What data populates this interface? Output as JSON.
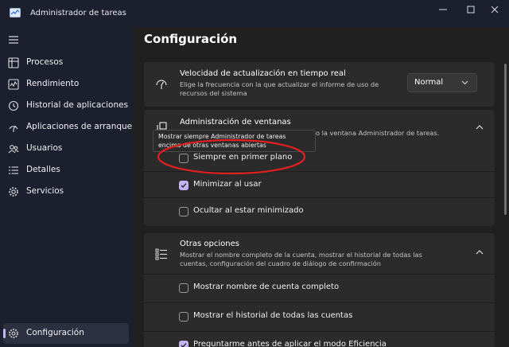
{
  "window": {
    "title": "Administrador de tareas",
    "controls": [
      "minimize",
      "maximize",
      "close"
    ]
  },
  "sidebar": {
    "items": [
      {
        "label": "Procesos",
        "icon": "processes-icon"
      },
      {
        "label": "Rendimiento",
        "icon": "performance-icon"
      },
      {
        "label": "Historial de aplicaciones",
        "icon": "history-icon"
      },
      {
        "label": "Aplicaciones de arranque",
        "icon": "startup-icon"
      },
      {
        "label": "Usuarios",
        "icon": "users-icon"
      },
      {
        "label": "Detalles",
        "icon": "details-icon"
      },
      {
        "label": "Servicios",
        "icon": "services-icon"
      }
    ],
    "footer": {
      "label": "Configuración",
      "icon": "gear-icon",
      "active": true
    }
  },
  "main": {
    "title": "Configuración",
    "update_speed": {
      "title": "Velocidad de actualización en tiempo real",
      "description": "Elige la frecuencia con la que actualizar el informe de uso de recursos del sistema",
      "selected": "Normal"
    },
    "window_management": {
      "title": "Administración de ventanas",
      "description_visible": "o la ventana Administrador de tareas.",
      "options": [
        {
          "label": "Siempre en primer plano",
          "checked": false
        },
        {
          "label": "Minimizar al usar",
          "checked": true
        },
        {
          "label": "Ocultar al estar minimizado",
          "checked": false
        }
      ]
    },
    "tooltip": {
      "text": "Mostrar siempre Administrador de tareas encima de otras ventanas abiertas"
    },
    "other_options": {
      "title": "Otras opciones",
      "description": "Mostrar el nombre completo de la cuenta, mostrar el historial de todas las cuentas, configuración del cuadro de diálogo de confirmación",
      "options": [
        {
          "label": "Mostrar nombre de cuenta completo",
          "checked": false
        },
        {
          "label": "Mostrar el historial de todas las cuentas",
          "checked": false
        },
        {
          "label": "Preguntarme antes de aplicar el modo Eficiencia",
          "checked": true
        }
      ]
    }
  },
  "colors": {
    "accent": "#c3b5f5",
    "annotation": "#e02020",
    "sidebar_bg": "#1c1f2e",
    "card_bg": "#2b2b2b"
  }
}
